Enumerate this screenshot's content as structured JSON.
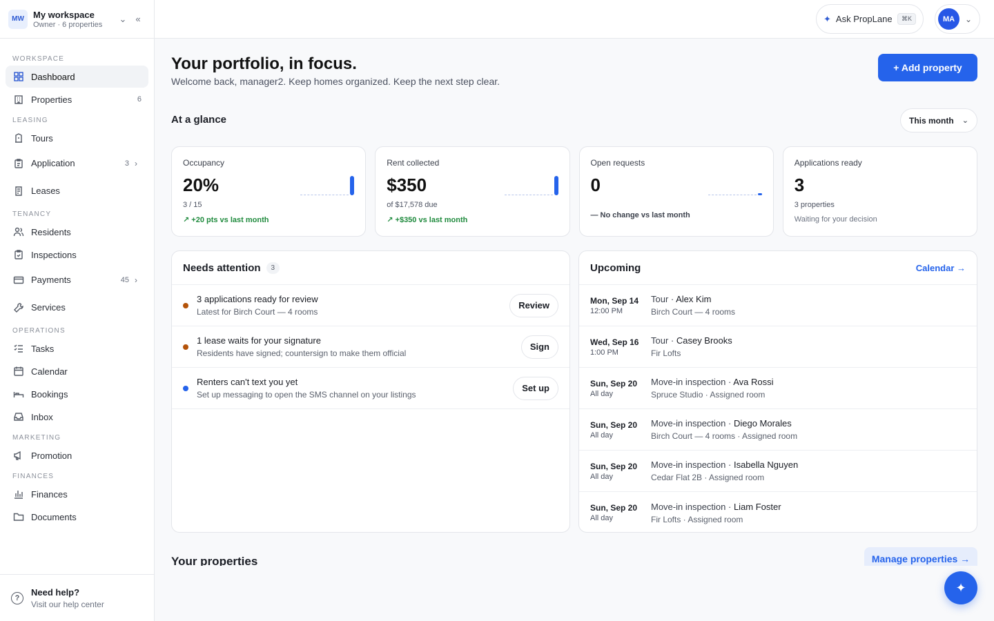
{
  "workspace": {
    "badge": "MW",
    "name": "My workspace",
    "role": "Owner · 6 properties"
  },
  "sidebar": {
    "sections": [
      {
        "heading": "WORKSPACE",
        "items": [
          {
            "label": "Dashboard",
            "icon": "dashboard-icon",
            "active": true
          },
          {
            "label": "Properties",
            "icon": "building-icon",
            "count": "6"
          }
        ]
      },
      {
        "heading": "LEASING",
        "items": [
          {
            "label": "Tours",
            "icon": "tours-icon"
          },
          {
            "label": "Application",
            "icon": "clipboard-icon",
            "count": "3",
            "chevron": true
          },
          {
            "label": "Leases",
            "icon": "lease-icon"
          }
        ]
      },
      {
        "heading": "TENANCY",
        "items": [
          {
            "label": "Residents",
            "icon": "residents-icon"
          },
          {
            "label": "Inspections",
            "icon": "inspection-icon"
          },
          {
            "label": "Payments",
            "icon": "card-icon",
            "count": "45",
            "chevron": true
          },
          {
            "label": "Services",
            "icon": "wrench-icon"
          }
        ]
      },
      {
        "heading": "OPERATIONS",
        "items": [
          {
            "label": "Tasks",
            "icon": "tasks-icon"
          },
          {
            "label": "Calendar",
            "icon": "calendar-icon"
          },
          {
            "label": "Bookings",
            "icon": "bed-icon"
          },
          {
            "label": "Inbox",
            "icon": "inbox-icon"
          }
        ]
      },
      {
        "heading": "MARKETING",
        "items": [
          {
            "label": "Promotion",
            "icon": "megaphone-icon"
          }
        ]
      },
      {
        "heading": "FINANCES",
        "items": [
          {
            "label": "Finances",
            "icon": "chart-icon"
          },
          {
            "label": "Documents",
            "icon": "folder-icon"
          }
        ]
      }
    ],
    "help": {
      "title": "Need help?",
      "subtitle": "Visit our help center"
    }
  },
  "topbar": {
    "ask_label": "Ask PropLane",
    "ask_shortcut": "⌘K",
    "avatar": "MA"
  },
  "header": {
    "title": "Your portfolio, in focus.",
    "subtitle": "Welcome back, manager2. Keep homes organized. Keep the next step clear.",
    "add_label": "+ Add property"
  },
  "glance": {
    "title": "At a glance",
    "range": "This month"
  },
  "cards": [
    {
      "label": "Occupancy",
      "value": "20%",
      "sub": "3 / 15",
      "trend": "↗ +20 pts vs last month",
      "trend_kind": "up",
      "spark_level": 1.0
    },
    {
      "label": "Rent collected",
      "value": "$350",
      "sub": "of $17,578 due",
      "trend": "↗ +$350 vs last month",
      "trend_kind": "up",
      "spark_level": 1.0
    },
    {
      "label": "Open requests",
      "value": "0",
      "sub": "",
      "trend": "— No change vs last month",
      "trend_kind": "neutral",
      "spark_level": 0.1
    },
    {
      "label": "Applications ready",
      "value": "3",
      "sub": "3 properties",
      "trend": "Waiting for your decision",
      "trend_kind": "gray",
      "spark_level": null
    }
  ],
  "attention": {
    "title": "Needs attention",
    "count": "3",
    "items": [
      {
        "title": "3 applications ready for review",
        "subtitle": "Latest for Birch Court — 4 rooms",
        "action": "Review",
        "dot_color": "#b45309"
      },
      {
        "title": "1 lease waits for your signature",
        "subtitle": "Residents have signed; countersign to make them official",
        "action": "Sign",
        "dot_color": "#b45309"
      },
      {
        "title": "Renters can't text you yet",
        "subtitle": "Set up messaging to open the SMS channel on your listings",
        "action": "Set up",
        "dot_color": "#2563eb"
      }
    ]
  },
  "upcoming": {
    "title": "Upcoming",
    "link": "Calendar →",
    "items": [
      {
        "day": "Mon, Sep 14",
        "time": "12:00 PM",
        "type": "Tour · ",
        "name": "Alex Kim",
        "detail": "Birch Court — 4 rooms"
      },
      {
        "day": "Wed, Sep 16",
        "time": "1:00 PM",
        "type": "Tour · ",
        "name": "Casey Brooks",
        "detail": "Fir Lofts"
      },
      {
        "day": "Sun, Sep 20",
        "time": "All day",
        "type": "Move-in inspection · ",
        "name": "Ava Rossi",
        "detail": "Spruce Studio · Assigned room"
      },
      {
        "day": "Sun, Sep 20",
        "time": "All day",
        "type": "Move-in inspection · ",
        "name": "Diego Morales",
        "detail": "Birch Court — 4 rooms · Assigned room"
      },
      {
        "day": "Sun, Sep 20",
        "time": "All day",
        "type": "Move-in inspection · ",
        "name": "Isabella Nguyen",
        "detail": "Cedar Flat 2B · Assigned room"
      },
      {
        "day": "Sun, Sep 20",
        "time": "All day",
        "type": "Move-in inspection · ",
        "name": "Liam Foster",
        "detail": "Fir Lofts · Assigned room"
      }
    ]
  },
  "properties": {
    "title": "Your properties",
    "manage_label": "Manage properties →"
  },
  "fab": {
    "icon": "sparkle-icon",
    "glyph": "✦"
  }
}
